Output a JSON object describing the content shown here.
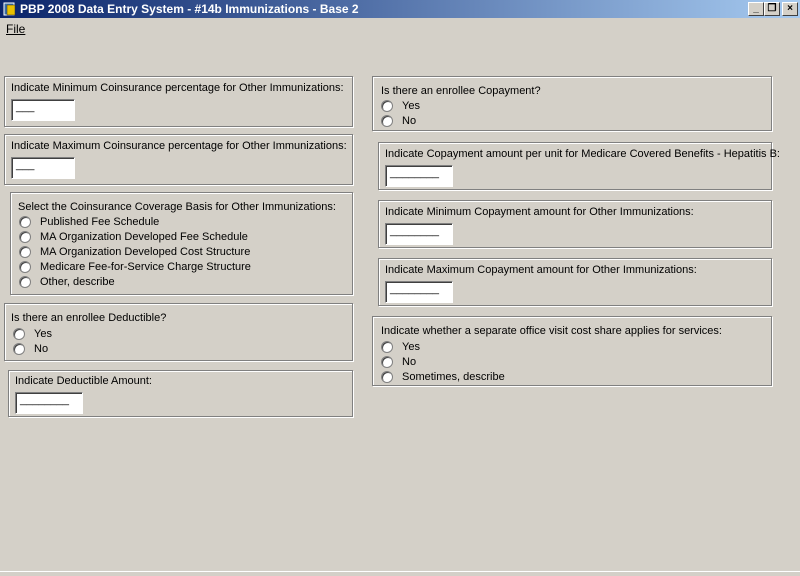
{
  "window": {
    "title": "PBP 2008 Data Entry System - #14b Immunizations - Base 2",
    "min_glyph": "_",
    "max_glyph": "❐",
    "close_glyph": "×"
  },
  "menu": {
    "file": "File"
  },
  "left": {
    "min_coins": {
      "label": "Indicate Minimum Coinsurance percentage for Other Immunizations:",
      "value": "___"
    },
    "max_coins": {
      "label": "Indicate Maximum Coinsurance percentage for Other Immunizations:",
      "value": "___"
    },
    "coverage_basis": {
      "label": "Select the Coinsurance Coverage Basis for Other Immunizations:",
      "options": [
        "Published Fee Schedule",
        "MA Organization Developed Fee Schedule",
        "MA Organization Developed Cost Structure",
        "Medicare Fee-for-Service Charge Structure",
        "Other, describe"
      ]
    },
    "deductible": {
      "label": "Is there an enrollee Deductible?",
      "options": [
        "Yes",
        "No"
      ]
    },
    "deductible_amount": {
      "label": "Indicate Deductible Amount:",
      "value": "________"
    }
  },
  "right": {
    "copayment": {
      "label": "Is there an enrollee Copayment?",
      "options": [
        "Yes",
        "No"
      ]
    },
    "copay_hepb": {
      "label": "Indicate Copayment amount per unit for Medicare Covered Benefits - Hepatitis B:",
      "value": "________"
    },
    "min_copay": {
      "label": "Indicate Minimum Copayment amount for Other Immunizations:",
      "value": "________"
    },
    "max_copay": {
      "label": "Indicate Maximum Copayment amount for Other Immunizations:",
      "value": "________"
    },
    "office_visit": {
      "label": "Indicate whether a separate office visit cost share applies for services:",
      "options": [
        "Yes",
        "No",
        "Sometimes, describe"
      ]
    }
  },
  "icons": {
    "app": "app-book-icon"
  }
}
